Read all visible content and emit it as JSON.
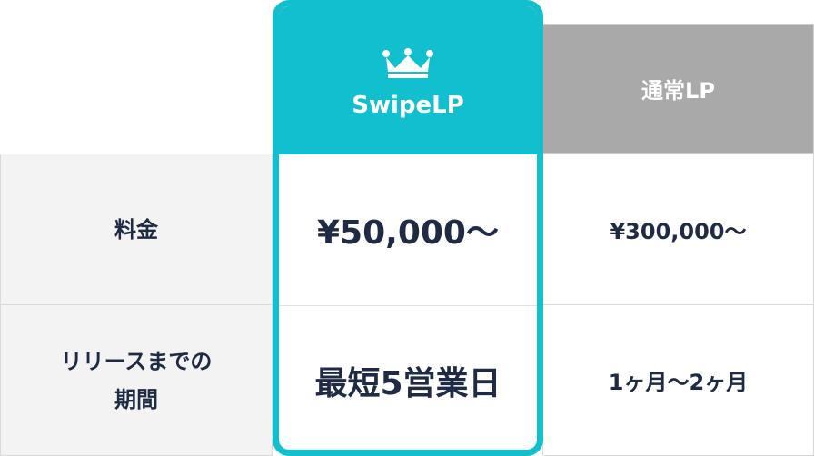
{
  "table": {
    "rows": {
      "price_label": "料金",
      "release_label_line1": "リリースまでの",
      "release_label_line2": "期間"
    },
    "swipe": {
      "header": "SwipeLP",
      "price": "¥50,000〜",
      "release": "最短5営業日",
      "accent_color": "#12bfce"
    },
    "normal": {
      "header": "通常LP",
      "price": "¥300,000〜",
      "release": "1ヶ月〜2ヶ月",
      "header_color": "#a9a9a9"
    },
    "icons": {
      "crown": "crown-icon"
    }
  }
}
